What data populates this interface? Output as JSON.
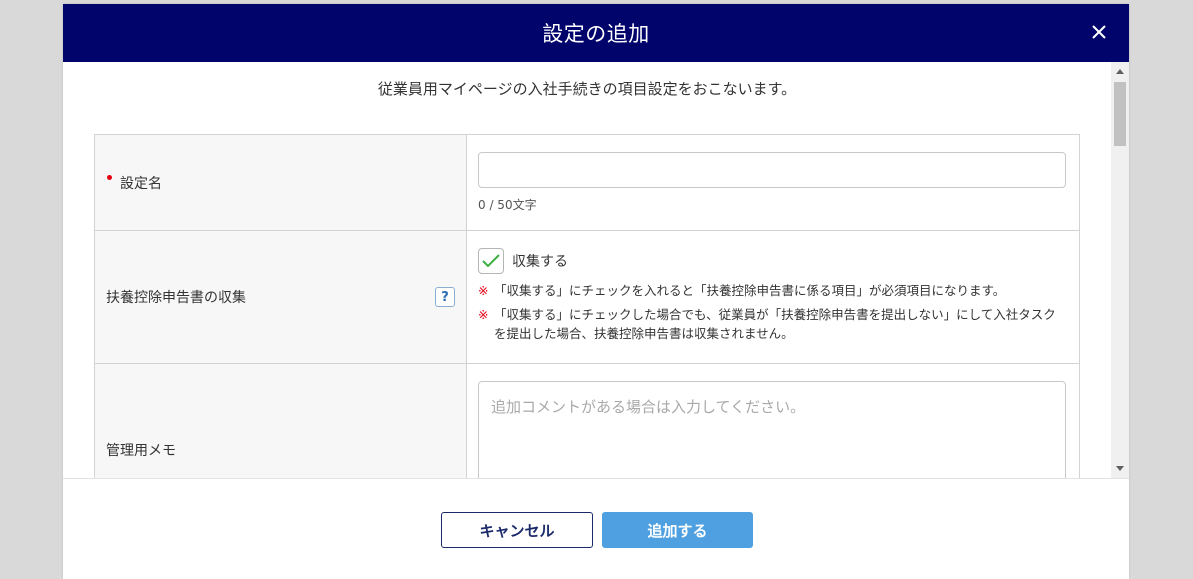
{
  "modal": {
    "title": "設定の追加",
    "close_label": "×",
    "description": "従業員用マイページの入社手続きの項目設定をおこないます。"
  },
  "form": {
    "name_field": {
      "label": "設定名",
      "required": true,
      "value": "",
      "char_count": "0 / 50文字"
    },
    "dependent_form": {
      "label": "扶養控除申告書の収集",
      "help_label": "?",
      "checkbox_label": "収集する",
      "checked": true,
      "notes": [
        {
          "mark": "※",
          "text": "「収集する」にチェックを入れると「扶養控除申告書に係る項目」が必須項目になります。"
        },
        {
          "mark": "※",
          "text": "「収集する」にチェックした場合でも、従業員が「扶養控除申告書を提出しない」にして入社タスクを提出した場合、扶養控除申告書は収集されません。"
        }
      ]
    },
    "memo_field": {
      "label": "管理用メモ",
      "placeholder": "追加コメントがある場合は入力してください。"
    }
  },
  "footer": {
    "cancel_label": "キャンセル",
    "submit_label": "追加する"
  },
  "colors": {
    "header_bg": "#00046b",
    "required": "#e60012",
    "primary_button": "#4fa0e0",
    "check": "#3cb043"
  }
}
